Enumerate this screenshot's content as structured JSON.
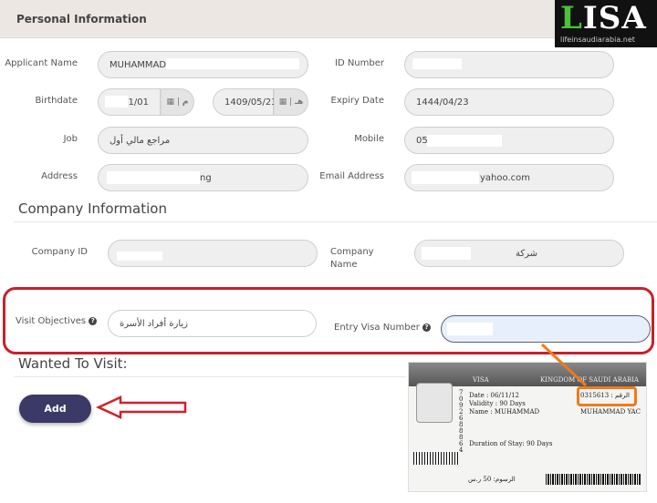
{
  "header": {
    "title": "Personal Information"
  },
  "logo": {
    "text_green": "L",
    "text_white": "ISA",
    "subtitle": "lifeinsaudiarabia.net"
  },
  "personal": {
    "applicant_name": {
      "label": "Applicant Name",
      "value": "MUHAMMAD J"
    },
    "id_number": {
      "label": "ID Number",
      "value": ""
    },
    "birthdate": {
      "label": "Birthdate",
      "gregorian_value": "/01/01",
      "gregorian_addon": "م",
      "hijri_value": "1409/05/23",
      "hijri_addon": "هـ"
    },
    "expiry_date": {
      "label": "Expiry Date",
      "value": "1444/04/23"
    },
    "job": {
      "label": "Job",
      "value": "مراجع مالي أول"
    },
    "mobile": {
      "label": "Mobile",
      "value": "059"
    },
    "address": {
      "label": "Address",
      "value": "ng"
    },
    "email": {
      "label": "Email Address",
      "value": "yahoo.com"
    }
  },
  "company": {
    "title": "Company Information",
    "company_id": {
      "label": "Company ID",
      "value": ""
    },
    "company_name": {
      "label": "Company Name",
      "value": "شركة"
    }
  },
  "visit": {
    "objectives": {
      "label": "Visit Objectives",
      "value": "زيارة أفراد الأسرة"
    },
    "entry_visa": {
      "label": "Entry Visa Number",
      "value": ""
    },
    "help_icon": "?"
  },
  "wanted": {
    "title": "Wanted To Visit:",
    "add_label": "Add"
  },
  "visa_card": {
    "header": "VISA",
    "header_right": "KINGDOM OF SAUDI ARABIA",
    "date": "Date : 06/11/12",
    "validity": "Validity : 90 Days",
    "name": "Name : MUHAMMAD",
    "duration": "Duration of Stay: 90 Days",
    "number": "0315613 : الرقم",
    "name_right": "MUHAMMAD YAC",
    "fee": "الرسوم: 50 ر.س",
    "side_digits": "7092688864"
  },
  "colors": {
    "highlight": "#c8202a",
    "arrow": "#f07a1a",
    "button": "#3b3a66",
    "logo_green": "#4cc23a"
  }
}
